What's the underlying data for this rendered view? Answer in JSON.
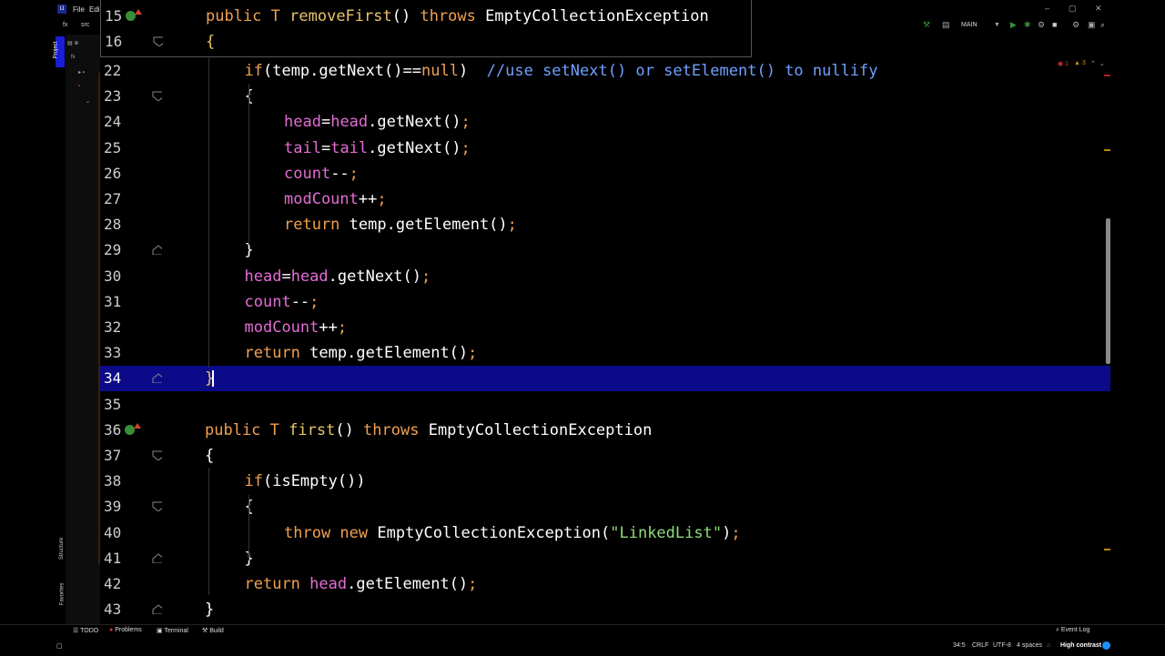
{
  "menu": {
    "file": "File",
    "edit": "Edi"
  },
  "breadcrumb": [
    "fx",
    "src"
  ],
  "run_config": "MAIN",
  "window_controls": {
    "minimize": "–",
    "restore": "▢",
    "close": "✕"
  },
  "sidebar": {
    "project_tab": "Project",
    "structure_tab": "Structure",
    "favorites_tab": "Favorites",
    "tree_root": "fx"
  },
  "sticky_header": [
    {
      "num": "15",
      "tokens": [
        [
          "kw",
          "public "
        ],
        [
          "cls",
          "T "
        ],
        [
          "fn",
          "removeFirst"
        ],
        [
          "plain",
          "() "
        ],
        [
          "kw",
          "throws "
        ],
        [
          "plain",
          "EmptyCollectionException"
        ]
      ]
    },
    {
      "num": "16",
      "tokens": [
        [
          "fn",
          "{"
        ]
      ]
    }
  ],
  "editor": {
    "current_line": "34",
    "lines": [
      {
        "num": "22",
        "indent": 2,
        "tokens": [
          [
            "kw",
            "if"
          ],
          [
            "plain",
            "(temp.getNext()=="
          ],
          [
            "kw",
            "null"
          ],
          [
            "plain",
            ")  "
          ],
          [
            "cmt",
            "//use setNext() or setElement() to nullify"
          ]
        ]
      },
      {
        "num": "23",
        "indent": 2,
        "tokens": [
          [
            "plain",
            "{"
          ]
        ]
      },
      {
        "num": "24",
        "indent": 3,
        "tokens": [
          [
            "fld",
            "head"
          ],
          [
            "plain",
            "="
          ],
          [
            "fld",
            "head"
          ],
          [
            "plain",
            ".getNext()"
          ],
          [
            "kw",
            ";"
          ]
        ]
      },
      {
        "num": "25",
        "indent": 3,
        "tokens": [
          [
            "fld",
            "tail"
          ],
          [
            "plain",
            "="
          ],
          [
            "fld",
            "tail"
          ],
          [
            "plain",
            ".getNext()"
          ],
          [
            "kw",
            ";"
          ]
        ]
      },
      {
        "num": "26",
        "indent": 3,
        "tokens": [
          [
            "fld",
            "count"
          ],
          [
            "plain",
            "--"
          ],
          [
            "kw",
            ";"
          ]
        ]
      },
      {
        "num": "27",
        "indent": 3,
        "tokens": [
          [
            "fld",
            "modCount"
          ],
          [
            "plain",
            "++"
          ],
          [
            "kw",
            ";"
          ]
        ]
      },
      {
        "num": "28",
        "indent": 3,
        "tokens": [
          [
            "kw",
            "return "
          ],
          [
            "plain",
            "temp.getElement()"
          ],
          [
            "kw",
            ";"
          ]
        ]
      },
      {
        "num": "29",
        "indent": 2,
        "tokens": [
          [
            "plain",
            "}"
          ]
        ]
      },
      {
        "num": "30",
        "indent": 2,
        "tokens": [
          [
            "fld",
            "head"
          ],
          [
            "plain",
            "="
          ],
          [
            "fld",
            "head"
          ],
          [
            "plain",
            ".getNext()"
          ],
          [
            "kw",
            ";"
          ]
        ]
      },
      {
        "num": "31",
        "indent": 2,
        "tokens": [
          [
            "fld",
            "count"
          ],
          [
            "plain",
            "--"
          ],
          [
            "kw",
            ";"
          ]
        ]
      },
      {
        "num": "32",
        "indent": 2,
        "tokens": [
          [
            "fld",
            "modCount"
          ],
          [
            "plain",
            "++"
          ],
          [
            "kw",
            ";"
          ]
        ]
      },
      {
        "num": "33",
        "indent": 2,
        "tokens": [
          [
            "kw",
            "return "
          ],
          [
            "plain",
            "temp.getElement()"
          ],
          [
            "kw",
            ";"
          ]
        ]
      },
      {
        "num": "34",
        "indent": 1,
        "tokens": [
          [
            "fn",
            "}"
          ]
        ]
      },
      {
        "num": "35",
        "indent": 0,
        "tokens": []
      },
      {
        "num": "36",
        "indent": 1,
        "tokens": [
          [
            "kw",
            "public "
          ],
          [
            "cls",
            "T "
          ],
          [
            "fn",
            "first"
          ],
          [
            "plain",
            "() "
          ],
          [
            "kw",
            "throws "
          ],
          [
            "plain",
            "EmptyCollectionException"
          ]
        ]
      },
      {
        "num": "37",
        "indent": 1,
        "tokens": [
          [
            "plain",
            "{"
          ]
        ]
      },
      {
        "num": "38",
        "indent": 2,
        "tokens": [
          [
            "kw",
            "if"
          ],
          [
            "plain",
            "(isEmpty())"
          ]
        ]
      },
      {
        "num": "39",
        "indent": 2,
        "tokens": [
          [
            "plain",
            "{"
          ]
        ]
      },
      {
        "num": "40",
        "indent": 3,
        "tokens": [
          [
            "kw",
            "throw "
          ],
          [
            "kw",
            "new "
          ],
          [
            "plain",
            "EmptyCollectionException("
          ],
          [
            "str",
            "\"LinkedList\""
          ],
          [
            "plain",
            ")"
          ],
          [
            "kw",
            ";"
          ]
        ]
      },
      {
        "num": "41",
        "indent": 2,
        "tokens": [
          [
            "plain",
            "}"
          ]
        ]
      },
      {
        "num": "42",
        "indent": 2,
        "tokens": [
          [
            "kw",
            "return "
          ],
          [
            "fld",
            "head"
          ],
          [
            "plain",
            ".getElement()"
          ],
          [
            "kw",
            ";"
          ]
        ]
      },
      {
        "num": "43",
        "indent": 1,
        "tokens": [
          [
            "plain",
            "}"
          ]
        ]
      }
    ]
  },
  "indicators": {
    "errors": "1",
    "warnings": "3"
  },
  "tool_windows": {
    "todo": "TODO",
    "problems": "Problems",
    "terminal": "Terminal",
    "build": "Build",
    "event_log": "Event Log"
  },
  "status": {
    "position": "34:5",
    "line_sep": "CRLF",
    "encoding": "UTF-8",
    "indent": "4 spaces",
    "theme": "High contrast"
  },
  "colors": {
    "keyword": "#f0a050",
    "method": "#e9c46a",
    "field": "#e26dd3",
    "string": "#8fdc7a",
    "comment": "#6fa0ff",
    "selection": "#0b0b8a"
  }
}
